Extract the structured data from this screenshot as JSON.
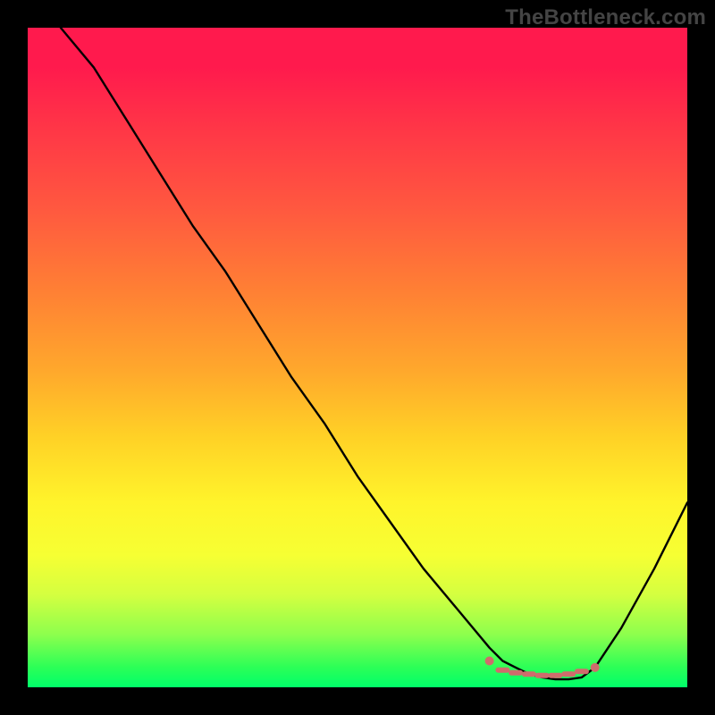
{
  "watermark": "TheBottleneck.com",
  "chart_data": {
    "type": "line",
    "title": "",
    "xlabel": "",
    "ylabel": "",
    "xlim": [
      0,
      100
    ],
    "ylim": [
      0,
      100
    ],
    "grid": false,
    "legend": false,
    "series": [
      {
        "name": "curve",
        "x": [
          5,
          10,
          15,
          20,
          25,
          30,
          35,
          40,
          45,
          50,
          55,
          60,
          65,
          70,
          72,
          74,
          76,
          78,
          80,
          82,
          84,
          86,
          90,
          95,
          100
        ],
        "y": [
          100,
          94,
          86,
          78,
          70,
          63,
          55,
          47,
          40,
          32,
          25,
          18,
          12,
          6,
          4,
          3,
          2,
          1.5,
          1.2,
          1.2,
          1.5,
          3,
          9,
          18,
          28
        ]
      }
    ],
    "optimal_region": {
      "x_start": 70,
      "x_end": 86,
      "y": 2
    },
    "markers": {
      "dots_x": [
        70,
        86
      ],
      "dots_y": [
        4,
        3
      ],
      "dashes": [
        {
          "x": 72,
          "y": 2.6
        },
        {
          "x": 74,
          "y": 2.2
        },
        {
          "x": 76,
          "y": 2.0
        },
        {
          "x": 78,
          "y": 1.8
        },
        {
          "x": 80,
          "y": 1.8
        },
        {
          "x": 82,
          "y": 2.0
        },
        {
          "x": 84,
          "y": 2.4
        }
      ]
    }
  }
}
